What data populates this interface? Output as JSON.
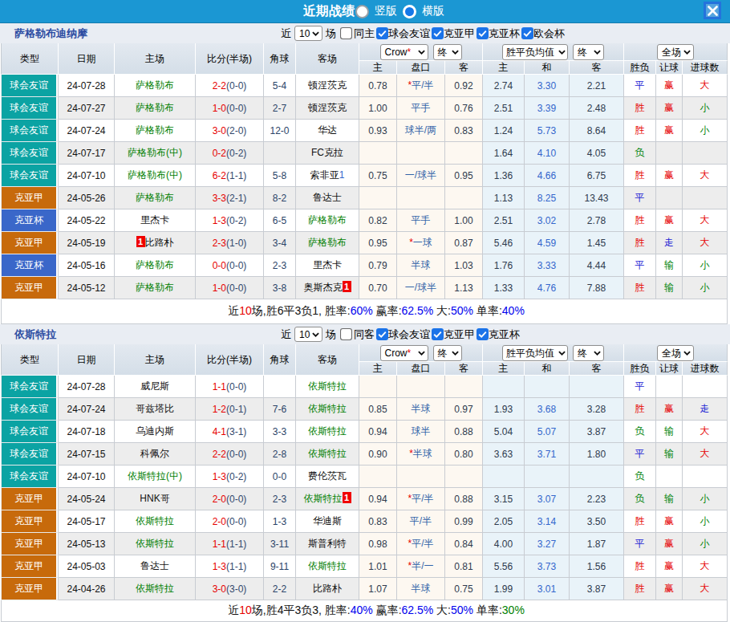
{
  "title_bar": {
    "title": "近期战绩",
    "layout_options": [
      {
        "label": "竖版",
        "selected": true
      },
      {
        "label": "横版",
        "selected": false
      }
    ],
    "close_label": "close"
  },
  "colors": {
    "accent_blue": "#1B97D3",
    "type_friendly": "#0BA3A3",
    "type_league": "#C76A0B",
    "type_cup": "#3A67C9",
    "win_red": "#E60000",
    "draw_blue": "#2121D4",
    "lose_green": "#00840A",
    "team_green": "#008000"
  },
  "table_header": {
    "left_cols": [
      "类型",
      "日期",
      "主场",
      "比分(半场)",
      "角球",
      "客场"
    ],
    "asia_selects": [
      {
        "label": "Crow",
        "star": "*"
      },
      {
        "label": "终",
        "star": ""
      }
    ],
    "europe_selects": [
      {
        "label": "胜平负均值",
        "star": ""
      },
      {
        "label": "终",
        "star": ""
      }
    ],
    "result_selects": [
      {
        "label": "全场",
        "star": ""
      }
    ],
    "sub_cols": [
      "主",
      "盘口",
      "客",
      "主",
      "和",
      "客",
      "胜负",
      "让球",
      "进球数"
    ]
  },
  "sections": [
    {
      "team": "萨格勒布迪纳摩",
      "filter": {
        "near_label": "近",
        "games_value": "10",
        "games_unit": "场",
        "venue": {
          "label": "同主",
          "checked": false
        },
        "competitions": [
          {
            "label": "球会友谊",
            "checked": true
          },
          {
            "label": "克亚甲",
            "checked": true
          },
          {
            "label": "克亚杯",
            "checked": true
          },
          {
            "label": "欧会杯",
            "checked": true
          }
        ]
      },
      "rows": [
        {
          "type": "球会友谊",
          "tc": "friendly",
          "date": "24-07-28",
          "home": {
            "text": "萨格勒布",
            "green": true
          },
          "ft": "2-2",
          "ht": "(0-0)",
          "corner": "5-4",
          "away": {
            "text": "顿涅茨克"
          },
          "asia": {
            "h": "0.78",
            "star": "*",
            "line": "平/半",
            "a": "0.92"
          },
          "euro": [
            "2.74",
            "3.30",
            "2.21"
          ],
          "res": [
            "平",
            "赢",
            "大"
          ]
        },
        {
          "type": "球会友谊",
          "tc": "friendly",
          "date": "24-07-27",
          "home": {
            "text": "萨格勒布",
            "green": true
          },
          "ft": "1-0",
          "ht": "(0-0)",
          "corner": "2-7",
          "away": {
            "text": "顿涅茨克"
          },
          "asia": {
            "h": "1.00",
            "star": "",
            "line": "平手",
            "a": "0.76"
          },
          "euro": [
            "2.51",
            "3.39",
            "2.48"
          ],
          "res": [
            "胜",
            "赢",
            "小"
          ]
        },
        {
          "type": "球会友谊",
          "tc": "friendly",
          "date": "24-07-24",
          "home": {
            "text": "萨格勒布",
            "green": true
          },
          "ft": "3-0",
          "ht": "(2-0)",
          "corner": "12-0",
          "away": {
            "text": "华达"
          },
          "asia": {
            "h": "0.93",
            "star": "",
            "line": "球半/两",
            "a": "0.83"
          },
          "euro": [
            "1.24",
            "5.73",
            "8.64"
          ],
          "res": [
            "胜",
            "赢",
            "小"
          ]
        },
        {
          "type": "球会友谊",
          "tc": "friendly",
          "date": "24-07-17",
          "home": {
            "text": "萨格勒布(中)",
            "green": true
          },
          "ft": "0-2",
          "ht": "(0-2)",
          "corner": "",
          "away": {
            "text": "FC克拉"
          },
          "asia": {
            "h": "",
            "star": "",
            "line": "",
            "a": ""
          },
          "euro": [
            "1.64",
            "4.10",
            "4.05"
          ],
          "res": [
            "负",
            "",
            ""
          ]
        },
        {
          "type": "球会友谊",
          "tc": "friendly",
          "date": "24-07-10",
          "home": {
            "text": "萨格勒布(中)",
            "green": true
          },
          "ft": "6-2",
          "ht": "(1-1)",
          "corner": "5-8",
          "away": {
            "text": "索非亚",
            "blue_suffix": "1"
          },
          "asia": {
            "h": "0.75",
            "star": "",
            "line": "一/球半",
            "a": "0.95"
          },
          "euro": [
            "1.36",
            "4.66",
            "6.75"
          ],
          "res": [
            "胜",
            "赢",
            "大"
          ]
        },
        {
          "type": "克亚甲",
          "tc": "league",
          "date": "24-05-26",
          "home": {
            "text": "萨格勒布",
            "green": true
          },
          "ft": "3-3",
          "ht": "(2-1)",
          "corner": "8-2",
          "away": {
            "text": "鲁达士"
          },
          "asia": {
            "h": "",
            "star": "",
            "line": "",
            "a": ""
          },
          "euro": [
            "1.13",
            "8.25",
            "13.43"
          ],
          "res": [
            "平",
            "",
            ""
          ]
        },
        {
          "type": "克亚杯",
          "tc": "cup",
          "date": "24-05-22",
          "home": {
            "text": "里杰卡"
          },
          "ft": "1-3",
          "ht": "(0-2)",
          "corner": "6-5",
          "away": {
            "text": "萨格勒布",
            "green": true
          },
          "asia": {
            "h": "0.82",
            "star": "",
            "line": "平手",
            "a": "1.00"
          },
          "euro": [
            "2.51",
            "3.02",
            "2.78"
          ],
          "res": [
            "胜",
            "赢",
            "大"
          ]
        },
        {
          "type": "克亚甲",
          "tc": "league",
          "date": "24-05-19",
          "home": {
            "text": "比路朴",
            "red_prefix": "1"
          },
          "ft": "2-3",
          "ht": "(1-0)",
          "corner": "3-4",
          "away": {
            "text": "萨格勒布",
            "green": true
          },
          "asia": {
            "h": "0.95",
            "star": "*",
            "line": "一球",
            "a": "0.87"
          },
          "euro": [
            "5.46",
            "4.59",
            "1.45"
          ],
          "res": [
            "胜",
            "走",
            "大"
          ]
        },
        {
          "type": "克亚杯",
          "tc": "cup",
          "date": "24-05-16",
          "home": {
            "text": "萨格勒布",
            "green": true
          },
          "ft": "0-0",
          "ht": "(0-0)",
          "corner": "2-3",
          "away": {
            "text": "里杰卡"
          },
          "asia": {
            "h": "0.79",
            "star": "",
            "line": "半球",
            "a": "1.03"
          },
          "euro": [
            "1.76",
            "3.33",
            "4.44"
          ],
          "res": [
            "平",
            "输",
            "小"
          ]
        },
        {
          "type": "克亚甲",
          "tc": "league",
          "date": "24-05-12",
          "home": {
            "text": "萨格勒布",
            "green": true
          },
          "ft": "1-0",
          "ht": "(0-0)",
          "corner": "3-8",
          "away": {
            "text": "奥斯杰克",
            "red_suffix": "1"
          },
          "asia": {
            "h": "0.70",
            "star": "",
            "line": "一/球半",
            "a": "1.13"
          },
          "euro": [
            "1.33",
            "4.76",
            "7.88"
          ],
          "res": [
            "胜",
            "输",
            "小"
          ]
        }
      ],
      "summary": [
        {
          "t": "近"
        },
        {
          "t": "10",
          "c": "red"
        },
        {
          "t": "场,胜6平3负1, 胜率:"
        },
        {
          "t": "60%",
          "c": "blue"
        },
        {
          "t": " 赢率:"
        },
        {
          "t": "62.5%",
          "c": "blue"
        },
        {
          "t": " 大:"
        },
        {
          "t": "50%",
          "c": "blue"
        },
        {
          "t": " 单率:"
        },
        {
          "t": "40%",
          "c": "blue"
        }
      ]
    },
    {
      "team": "依斯特拉",
      "filter": {
        "near_label": "近",
        "games_value": "10",
        "games_unit": "场",
        "venue": {
          "label": "同客",
          "checked": false
        },
        "competitions": [
          {
            "label": "球会友谊",
            "checked": true
          },
          {
            "label": "克亚甲",
            "checked": true
          },
          {
            "label": "克亚杯",
            "checked": true
          }
        ]
      },
      "rows": [
        {
          "type": "球会友谊",
          "tc": "friendly",
          "date": "24-07-28",
          "home": {
            "text": "威尼斯"
          },
          "ft": "1-1",
          "ht": "(0-0)",
          "corner": "",
          "away": {
            "text": "依斯特拉",
            "green": true
          },
          "asia": {
            "h": "",
            "star": "",
            "line": "",
            "a": ""
          },
          "euro": [
            "",
            "",
            ""
          ],
          "res": [
            "平",
            "",
            ""
          ]
        },
        {
          "type": "球会友谊",
          "tc": "friendly",
          "date": "24-07-24",
          "home": {
            "text": "哥兹塔比"
          },
          "ft": "1-2",
          "ht": "(0-1)",
          "corner": "7-6",
          "away": {
            "text": "依斯特拉",
            "green": true
          },
          "asia": {
            "h": "0.85",
            "star": "",
            "line": "半球",
            "a": "0.97"
          },
          "euro": [
            "1.93",
            "3.68",
            "3.28"
          ],
          "res": [
            "胜",
            "赢",
            "走"
          ]
        },
        {
          "type": "球会友谊",
          "tc": "friendly",
          "date": "24-07-18",
          "home": {
            "text": "乌迪内斯"
          },
          "ft": "4-1",
          "ht": "(3-1)",
          "corner": "3-3",
          "away": {
            "text": "依斯特拉",
            "green": true
          },
          "asia": {
            "h": "0.94",
            "star": "",
            "line": "球半",
            "a": "0.88"
          },
          "euro": [
            "5.04",
            "5.07",
            "3.87"
          ],
          "res": [
            "负",
            "输",
            "大"
          ]
        },
        {
          "type": "球会友谊",
          "tc": "friendly",
          "date": "24-07-15",
          "home": {
            "text": "科佩尔"
          },
          "ft": "2-2",
          "ht": "(0-0)",
          "corner": "2-8",
          "away": {
            "text": "依斯特拉",
            "green": true
          },
          "asia": {
            "h": "0.90",
            "star": "*",
            "line": "半球",
            "a": "0.80"
          },
          "euro": [
            "3.63",
            "3.71",
            "1.80"
          ],
          "res": [
            "平",
            "输",
            "大"
          ]
        },
        {
          "type": "球会友谊",
          "tc": "friendly",
          "date": "24-07-10",
          "home": {
            "text": "依斯特拉(中)",
            "green": true
          },
          "ft": "1-3",
          "ht": "(0-2)",
          "corner": "0-0",
          "away": {
            "text": "费伦茨瓦"
          },
          "asia": {
            "h": "",
            "star": "",
            "line": "",
            "a": ""
          },
          "euro": [
            "",
            "",
            ""
          ],
          "res": [
            "负",
            "",
            ""
          ]
        },
        {
          "type": "克亚甲",
          "tc": "league",
          "date": "24-05-24",
          "home": {
            "text": "HNK哥"
          },
          "ft": "2-0",
          "ht": "(0-0)",
          "corner": "2-3",
          "away": {
            "text": "依斯特拉",
            "green": true,
            "red_suffix": "1"
          },
          "asia": {
            "h": "0.94",
            "star": "*",
            "line": "平/半",
            "a": "0.88"
          },
          "euro": [
            "3.15",
            "3.07",
            "2.23"
          ],
          "res": [
            "负",
            "输",
            "小"
          ]
        },
        {
          "type": "克亚甲",
          "tc": "league",
          "date": "24-05-17",
          "home": {
            "text": "依斯特拉",
            "green": true
          },
          "ft": "2-0",
          "ht": "(0-0)",
          "corner": "1-3",
          "away": {
            "text": "华迪斯"
          },
          "asia": {
            "h": "0.83",
            "star": "",
            "line": "平/半",
            "a": "0.99"
          },
          "euro": [
            "2.05",
            "3.14",
            "3.50"
          ],
          "res": [
            "胜",
            "赢",
            "小"
          ]
        },
        {
          "type": "克亚甲",
          "tc": "league",
          "date": "24-05-13",
          "home": {
            "text": "依斯特拉",
            "green": true
          },
          "ft": "1-1",
          "ht": "(1-1)",
          "corner": "3-11",
          "away": {
            "text": "斯普利特"
          },
          "asia": {
            "h": "0.98",
            "star": "*",
            "line": "平/半",
            "a": "0.84"
          },
          "euro": [
            "4.00",
            "3.27",
            "1.87"
          ],
          "res": [
            "平",
            "赢",
            "小"
          ]
        },
        {
          "type": "克亚甲",
          "tc": "league",
          "date": "24-05-03",
          "home": {
            "text": "鲁达士"
          },
          "ft": "1-3",
          "ht": "(1-1)",
          "corner": "9-11",
          "away": {
            "text": "依斯特拉",
            "green": true
          },
          "asia": {
            "h": "1.01",
            "star": "*",
            "line": "半/一",
            "a": "0.81"
          },
          "euro": [
            "5.56",
            "3.73",
            "1.56"
          ],
          "res": [
            "胜",
            "赢",
            "大"
          ]
        },
        {
          "type": "克亚甲",
          "tc": "league",
          "date": "24-04-26",
          "home": {
            "text": "依斯特拉",
            "green": true
          },
          "ft": "3-0",
          "ht": "(3-0)",
          "corner": "2-2",
          "away": {
            "text": "比路朴"
          },
          "asia": {
            "h": "1.07",
            "star": "",
            "line": "半球",
            "a": "0.75"
          },
          "euro": [
            "1.99",
            "3.01",
            "3.87"
          ],
          "res": [
            "胜",
            "赢",
            "大"
          ]
        }
      ],
      "summary": [
        {
          "t": "近"
        },
        {
          "t": "10",
          "c": "red"
        },
        {
          "t": "场,胜4平3负3, 胜率:"
        },
        {
          "t": "40%",
          "c": "blue"
        },
        {
          "t": " 赢率:"
        },
        {
          "t": "62.5%",
          "c": "blue"
        },
        {
          "t": " 大:"
        },
        {
          "t": "50%",
          "c": "blue"
        },
        {
          "t": " 单率:"
        },
        {
          "t": "30%",
          "c": "green"
        }
      ]
    }
  ]
}
